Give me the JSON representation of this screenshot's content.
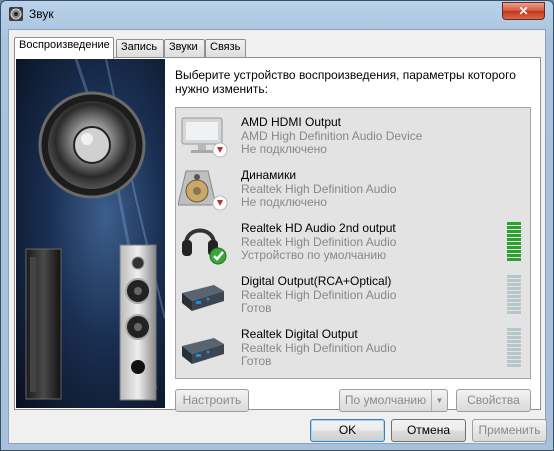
{
  "window": {
    "title": "Звук",
    "close_label": "✕"
  },
  "tabs": [
    {
      "label": "Воспроизведение",
      "active": true
    },
    {
      "label": "Запись",
      "active": false
    },
    {
      "label": "Звуки",
      "active": false
    },
    {
      "label": "Связь",
      "active": false
    }
  ],
  "prompt": "Выберите устройство воспроизведения, параметры которого нужно изменить:",
  "devices": [
    {
      "name": "AMD HDMI Output",
      "description": "AMD High Definition Audio Device",
      "status": "Не подключено",
      "icon": "monitor-icon",
      "badge": "disconnected-badge",
      "meter_level": 0,
      "meter_visible": false
    },
    {
      "name": "Динамики",
      "description": "Realtek High Definition Audio",
      "status": "Не подключено",
      "icon": "speaker-icon",
      "badge": "disconnected-badge",
      "meter_level": 0,
      "meter_visible": false
    },
    {
      "name": "Realtek HD Audio 2nd output",
      "description": "Realtek High Definition Audio",
      "status": "Устройство по умолчанию",
      "icon": "headphones-icon",
      "badge": "default-check-badge",
      "meter_level": 1.0,
      "meter_visible": true
    },
    {
      "name": "Digital Output(RCA+Optical)",
      "description": "Realtek High Definition Audio",
      "status": "Готов",
      "icon": "digital-output-icon",
      "badge": "",
      "meter_level": 0,
      "meter_visible": true
    },
    {
      "name": "Realtek Digital Output",
      "description": "Realtek High Definition Audio",
      "status": "Готов",
      "icon": "digital-output-icon",
      "badge": "",
      "meter_level": 0,
      "meter_visible": true
    }
  ],
  "buttons": {
    "configure": "Настроить",
    "set_default": "По умолчанию",
    "properties": "Свойства",
    "ok": "OK",
    "cancel": "Отмена",
    "apply": "Применить"
  },
  "colors": {
    "meter_active": "#2da12f",
    "meter_inactive": "#b7c6c9",
    "check_green": "#3aa63a",
    "disconnected_red": "#c0302a"
  }
}
